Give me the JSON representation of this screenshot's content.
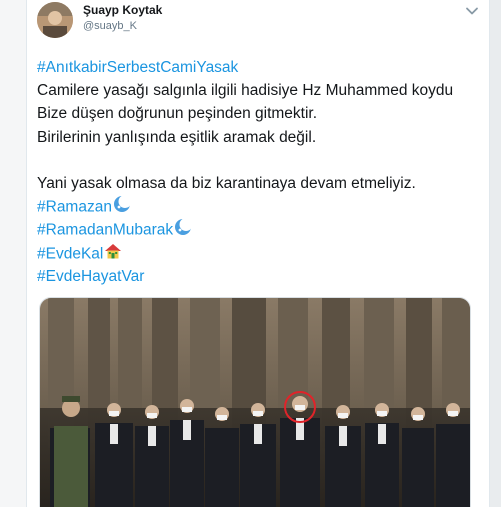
{
  "tweet": {
    "author_name": "Şuayp Koytak",
    "author_handle": "@suayb_K",
    "lines": {
      "l1": "#AnıtkabirSerbestCamiYasak",
      "l2": "Camilere yasağı salgınla ilgili hadisiye Hz Muhammed koydu",
      "l3": "Bize düşen doğrunun peşinden gitmektir.",
      "l4": "Birilerinin yanlışında eşitlik aramak değil.",
      "l5": "Yani yasak olmasa da biz karantinaya devam etmeliyiz.",
      "h1": "#Ramazan",
      "h2": "#RamadanMubarak",
      "h3": "#EvdeKal",
      "h4": "#EvdeHayatVar"
    }
  },
  "colors": {
    "hashtag": "#1b95e0",
    "text": "#14171a",
    "muted": "#657786"
  },
  "icons": {
    "menu": "chevron-down-icon",
    "ramazan": "crescent-moon-emoji-icon",
    "ramadan_mubarak": "crescent-moon-emoji-icon",
    "evdekal": "house-emoji-icon"
  }
}
